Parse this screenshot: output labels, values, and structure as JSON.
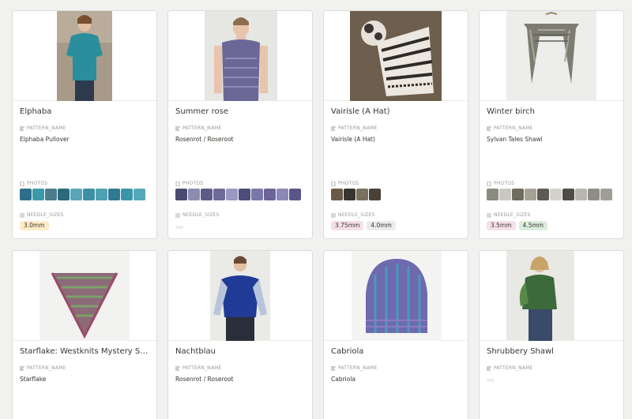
{
  "labels": {
    "pattern_name": "PATTERN_NAME",
    "photos": "PHOTOS",
    "needle_sizes": "NEEDLE_SIZES"
  },
  "cards": [
    {
      "title": "Elphaba",
      "pattern_name": "Elphaba Pullover",
      "photos": [
        "#2d6f8a",
        "#3a9aa8",
        "#4c7d8c",
        "#2b6a7c",
        "#5aa6b8",
        "#3d8fa3",
        "#4fa0b0",
        "#2f7a92",
        "#3a95a8",
        "#55a8b8"
      ],
      "needle_sizes": [
        {
          "text": "3.0mm",
          "bg": "#fdecc8"
        }
      ]
    },
    {
      "title": "Summer rose",
      "pattern_name": "Rosenrot / Roseroot",
      "photos": [
        "#4b4a70",
        "#8c8cb0",
        "#5e5b88",
        "#6d6a9a",
        "#9a98c2",
        "#4e4c7a",
        "#7a78a8",
        "#6c6396",
        "#8b88b8",
        "#5a5688"
      ],
      "needle_sizes": []
    },
    {
      "title": "Vairisle (A Hat)",
      "pattern_name": "Vairisle (A Hat)",
      "photos": [
        "#6a5a48",
        "#3a3530",
        "#7b6f60",
        "#4a4238"
      ],
      "needle_sizes": [
        {
          "text": "3.75mm",
          "bg": "#f5e0e9"
        },
        {
          "text": "4.0mm",
          "bg": "#ebebea"
        }
      ]
    },
    {
      "title": "Winter birch",
      "pattern_name": "Sylvan Tales Shawl",
      "photos": [
        "#8a8a80",
        "#c8c8c0",
        "#6f6c60",
        "#a6a296",
        "#5c5a52",
        "#d4d2cc",
        "#4e4c46",
        "#b8b6ae",
        "#8f8d84",
        "#a09e96"
      ],
      "needle_sizes": [
        {
          "text": "3.5mm",
          "bg": "#f5e0e9"
        },
        {
          "text": "4.5mm",
          "bg": "#dbeddb"
        }
      ]
    },
    {
      "title": "Starflake: Westknits Mystery Shawl...",
      "pattern_name": "Starflake"
    },
    {
      "title": "Nachtblau",
      "pattern_name": "Rosenrot / Roseroot"
    },
    {
      "title": "Cabriola",
      "pattern_name": "Cabriola"
    },
    {
      "title": "Shrubbery Shawl",
      "pattern_name": ""
    }
  ]
}
